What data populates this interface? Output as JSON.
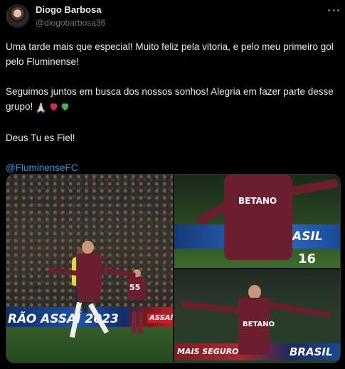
{
  "tweet": {
    "author": {
      "display_name": "Diogo Barbosa",
      "handle": "@diogobarbosa36"
    },
    "paragraphs": [
      "Uma tarde mais que especial! Muito feliz pela vitoria, e pelo meu primeiro gol pelo Fluminense!",
      "Seguimos juntos em busca dos nossos sonhos! Alegria em fazer parte desse grupo!",
      "Deus Tu es Fiel!"
    ],
    "emojis": [
      "🙏🏻",
      "❤️",
      "💚"
    ],
    "mention": "@FluminenseFC",
    "media_count": 3
  },
  "photos": {
    "left": {
      "board_text": "RÃO ASSAÍ 2023",
      "badge_text": "ASSAÍ",
      "player_number": "55"
    },
    "top_right": {
      "board_text": "BRASIL",
      "player_number": "16",
      "sponsor": "BETANO"
    },
    "bottom_right": {
      "board_text": "MAIS SEGURO",
      "board_text_2": "BRASIL",
      "sponsor": "BETANO"
    }
  },
  "colors": {
    "background": "#000000",
    "text": "#e7e9ea",
    "secondary_text": "#71767b",
    "link": "#1d9bf0",
    "border": "#2f3336"
  },
  "icons": [
    "more-icon",
    "avatar",
    "folded-hands-emoji",
    "red-heart-emoji",
    "green-heart-emoji"
  ]
}
